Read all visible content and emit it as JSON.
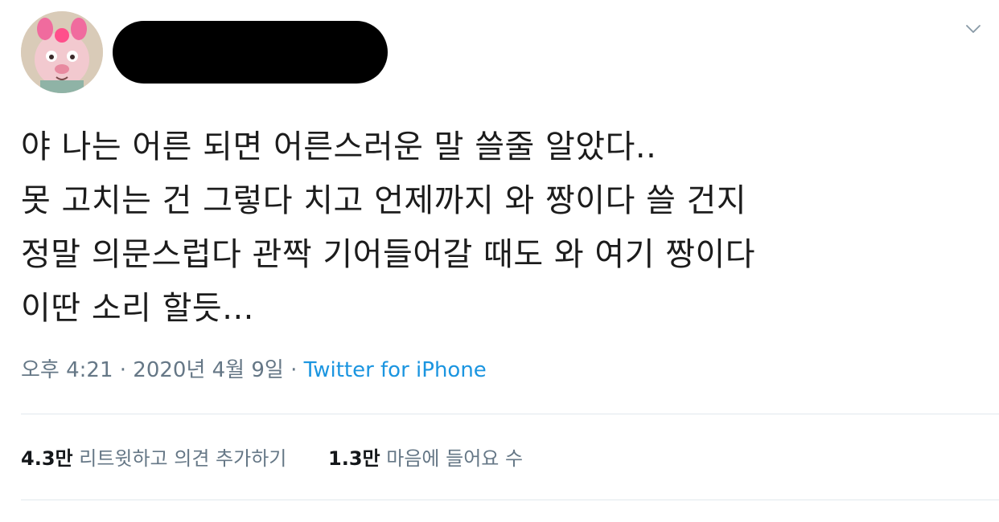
{
  "tweet": {
    "text_lines": [
      "야 나는 어른 되면 어른스러운 말 쓸줄 알았다..",
      "못 고치는 건 그렇다 치고 언제까지 와 짱이다 쓸 건지",
      "정말 의문스럽다 관짝 기어들어갈 때도 와 여기 짱이다",
      "이딴 소리 할듯..."
    ],
    "timestamp": "오후 4:21 · 2020년 4월 9일 · ",
    "source": "Twitter for iPhone",
    "retweets": {
      "count": "4.3만",
      "label": " 리트윗하고 의견 추가하기"
    },
    "likes": {
      "count": "1.3만",
      "label": " 마음에 들어요 수"
    }
  },
  "icons": {
    "avatar": "profile-avatar",
    "caret": "chevron-down-icon"
  },
  "colors": {
    "text": "#14171a",
    "secondary": "#657786",
    "link": "#1b95e0",
    "divider": "#e1e8ed"
  }
}
